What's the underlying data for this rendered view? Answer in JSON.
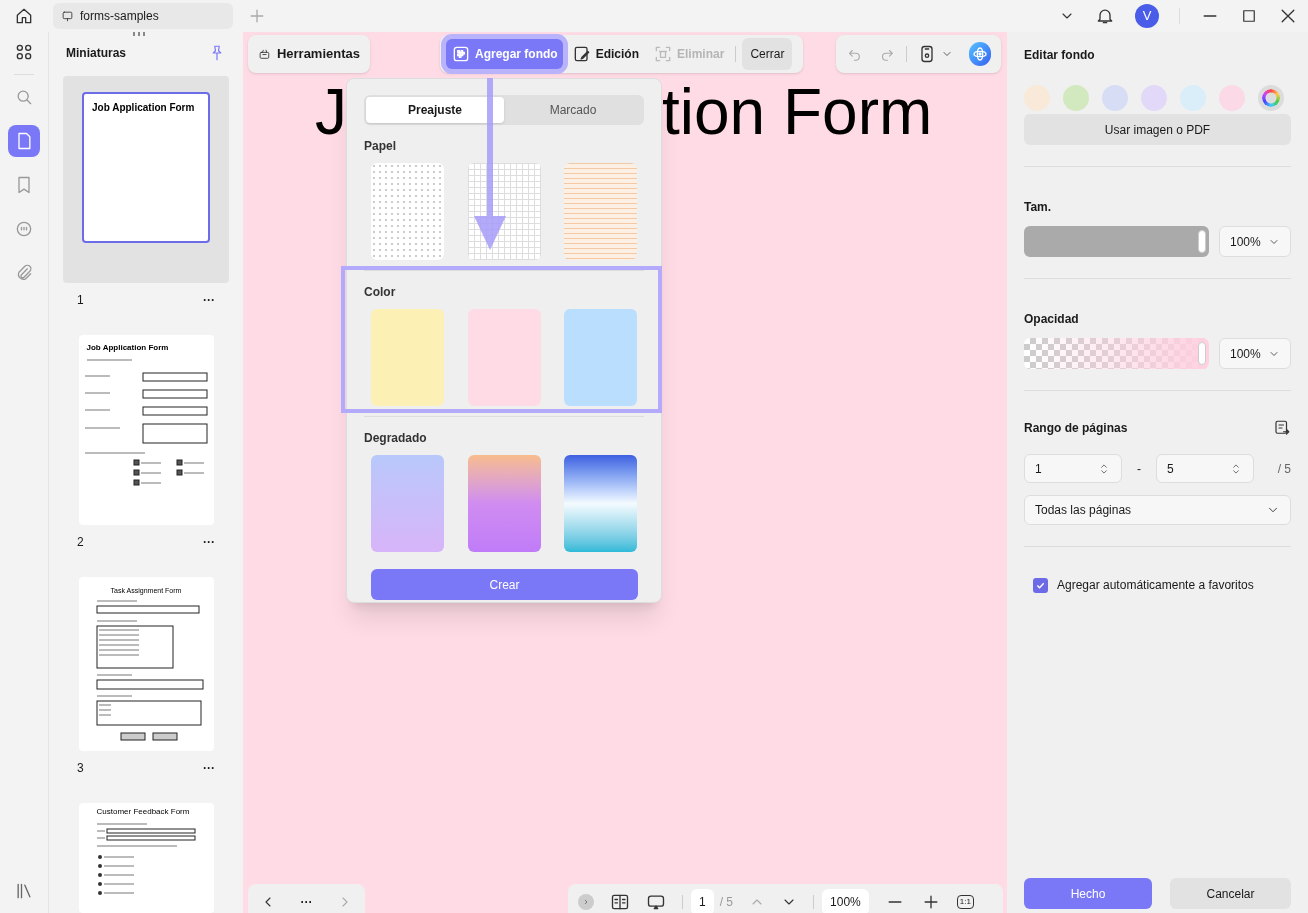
{
  "titlebar": {
    "tab": "forms-samples",
    "avatar": "V"
  },
  "thumbnails": {
    "title": "Miniaturas",
    "pages": [
      {
        "kind": "title_only",
        "number": "1",
        "more": "···",
        "selected": true,
        "title": "Job Application Form"
      },
      {
        "kind": "job_application",
        "number": "2",
        "more": "···",
        "selected": false,
        "title": "Job Application Form"
      },
      {
        "kind": "task",
        "number": "3",
        "more": "···",
        "selected": false,
        "title": "Task Assignment Form"
      },
      {
        "kind": "feedback",
        "selected": false,
        "title": "Customer Feedback Form"
      }
    ]
  },
  "toolbar": {
    "tools": "Herramientas",
    "items": [
      {
        "kind": "background",
        "label": "Agregar fondo",
        "selected": true,
        "disabled": false
      },
      {
        "kind": "edit",
        "label": "Edición",
        "selected": false,
        "disabled": false
      },
      {
        "kind": "delete",
        "label": "Eliminar",
        "selected": false,
        "disabled": true
      }
    ],
    "close": "Cerrar"
  },
  "document": {
    "title_left": "J",
    "title_right": "tion Form"
  },
  "popup": {
    "tabs": [
      {
        "label": "Preajuste",
        "selected": true
      },
      {
        "label": "Marcado",
        "selected": false
      }
    ],
    "sections": [
      {
        "title": "Papel",
        "items": [
          {
            "kind": "dots"
          },
          {
            "kind": "grid"
          },
          {
            "kind": "lined"
          }
        ]
      },
      {
        "title": "Color",
        "items": [
          {
            "kind": "solid",
            "color": "#fdf0b4"
          },
          {
            "kind": "solid",
            "color": "#ffdbe6"
          },
          {
            "kind": "solid",
            "color": "#b9defe"
          }
        ]
      },
      {
        "title": "Degradado",
        "items": [
          {
            "kind": "lavender"
          },
          {
            "kind": "sunset"
          },
          {
            "kind": "ocean"
          }
        ]
      }
    ],
    "create": "Crear"
  },
  "bottom": {
    "page": "1",
    "total": "/ 5",
    "zoom": "100%",
    "fit": "1:1",
    "more": "···"
  },
  "panel": {
    "title": "Editar fondo",
    "colors": [
      {
        "color": "#f8e9d8",
        "selected": false
      },
      {
        "color": "#d2e9c0",
        "selected": false
      },
      {
        "color": "#d6ddf5",
        "selected": false
      },
      {
        "color": "#e2d9f9",
        "selected": false
      },
      {
        "color": "#d9eef8",
        "selected": false
      },
      {
        "color": "#fbd9e6",
        "selected": false
      },
      {
        "kind": "custom",
        "selected": true
      }
    ],
    "use_image": "Usar imagen o PDF",
    "size": {
      "label": "Tam.",
      "level": 1,
      "value": "100%"
    },
    "opacity": {
      "label": "Opacidad",
      "level": 1,
      "value": "100%"
    },
    "range": {
      "label": "Rango de páginas",
      "from": "1",
      "dash": "-",
      "to": "5",
      "total": "/ 5",
      "pages": "Todas las páginas"
    },
    "favorite": {
      "label": "Agregar automáticamente a favoritos",
      "checked": true
    },
    "done": "Hecho",
    "cancel": "Cancelar"
  }
}
